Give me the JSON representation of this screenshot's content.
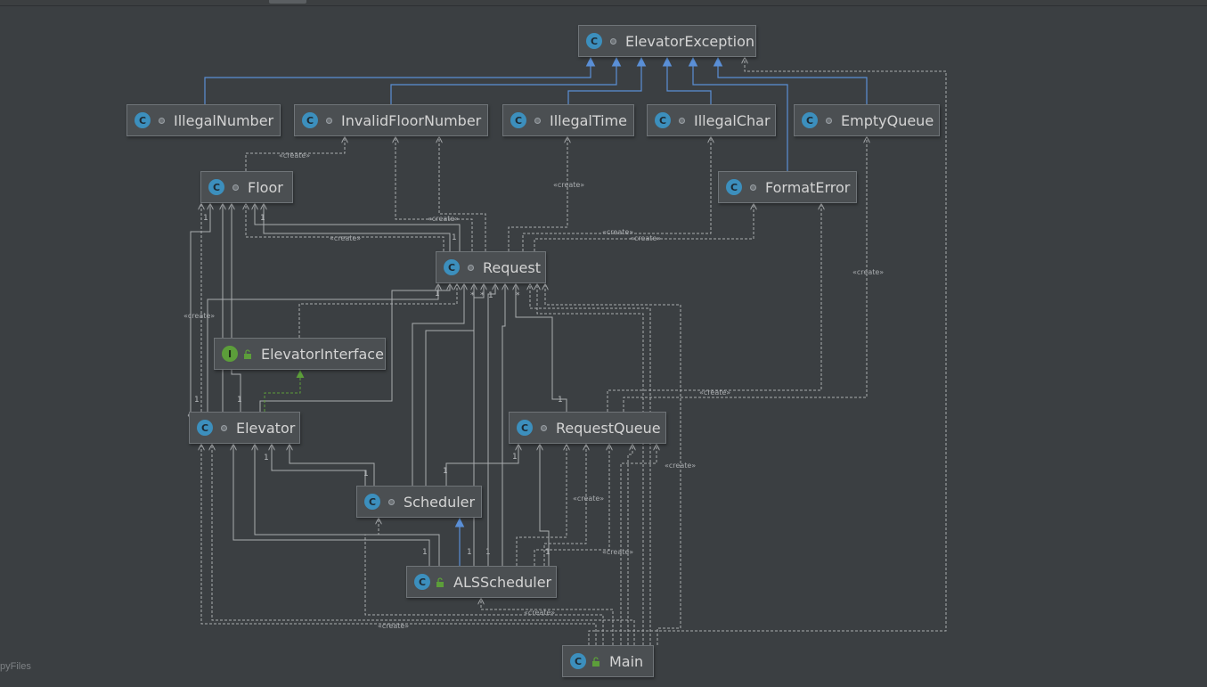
{
  "diagram": {
    "classes": [
      {
        "id": "ElevatorException",
        "label": "ElevatorException",
        "kind": "class",
        "visibility": "package"
      },
      {
        "id": "IllegalNumber",
        "label": "IllegalNumber",
        "kind": "class",
        "visibility": "package"
      },
      {
        "id": "InvalidFloorNumber",
        "label": "InvalidFloorNumber",
        "kind": "class",
        "visibility": "package"
      },
      {
        "id": "IllegalTime",
        "label": "IllegalTime",
        "kind": "class",
        "visibility": "package"
      },
      {
        "id": "IllegalChar",
        "label": "IllegalChar",
        "kind": "class",
        "visibility": "package"
      },
      {
        "id": "EmptyQueue",
        "label": "EmptyQueue",
        "kind": "class",
        "visibility": "package"
      },
      {
        "id": "Floor",
        "label": "Floor",
        "kind": "class",
        "visibility": "package"
      },
      {
        "id": "FormatError",
        "label": "FormatError",
        "kind": "class",
        "visibility": "package"
      },
      {
        "id": "Request",
        "label": "Request",
        "kind": "class",
        "visibility": "package"
      },
      {
        "id": "ElevatorInterface",
        "label": "ElevatorInterface",
        "kind": "interface",
        "visibility": "public"
      },
      {
        "id": "Elevator",
        "label": "Elevator",
        "kind": "class",
        "visibility": "package"
      },
      {
        "id": "RequestQueue",
        "label": "RequestQueue",
        "kind": "class",
        "visibility": "package"
      },
      {
        "id": "Scheduler",
        "label": "Scheduler",
        "kind": "class",
        "visibility": "package"
      },
      {
        "id": "ALSScheduler",
        "label": "ALSScheduler",
        "kind": "class",
        "visibility": "public"
      },
      {
        "id": "Main",
        "label": "Main",
        "kind": "main-class",
        "visibility": "public"
      }
    ],
    "inheritance": [
      {
        "from": "IllegalNumber",
        "to": "ElevatorException"
      },
      {
        "from": "InvalidFloorNumber",
        "to": "ElevatorException"
      },
      {
        "from": "IllegalTime",
        "to": "ElevatorException"
      },
      {
        "from": "IllegalChar",
        "to": "ElevatorException"
      },
      {
        "from": "EmptyQueue",
        "to": "ElevatorException"
      },
      {
        "from": "FormatError",
        "to": "ElevatorException"
      },
      {
        "from": "ALSScheduler",
        "to": "Scheduler"
      }
    ],
    "realization": [
      {
        "from": "Elevator",
        "to": "ElevatorInterface"
      }
    ],
    "create_label": "«create»",
    "multiplicity_one": "1",
    "multiplicity_many": "*"
  },
  "footer": {
    "text": "pyFiles"
  },
  "icons": {
    "class_badge": "C",
    "interface_badge": "I",
    "class_color": "#3c8fbd",
    "interface_color": "#5c9e3a",
    "generalization_color": "#5a8fd6",
    "realization_color": "#5c9e3a",
    "dependency_color": "#a9acaf"
  }
}
